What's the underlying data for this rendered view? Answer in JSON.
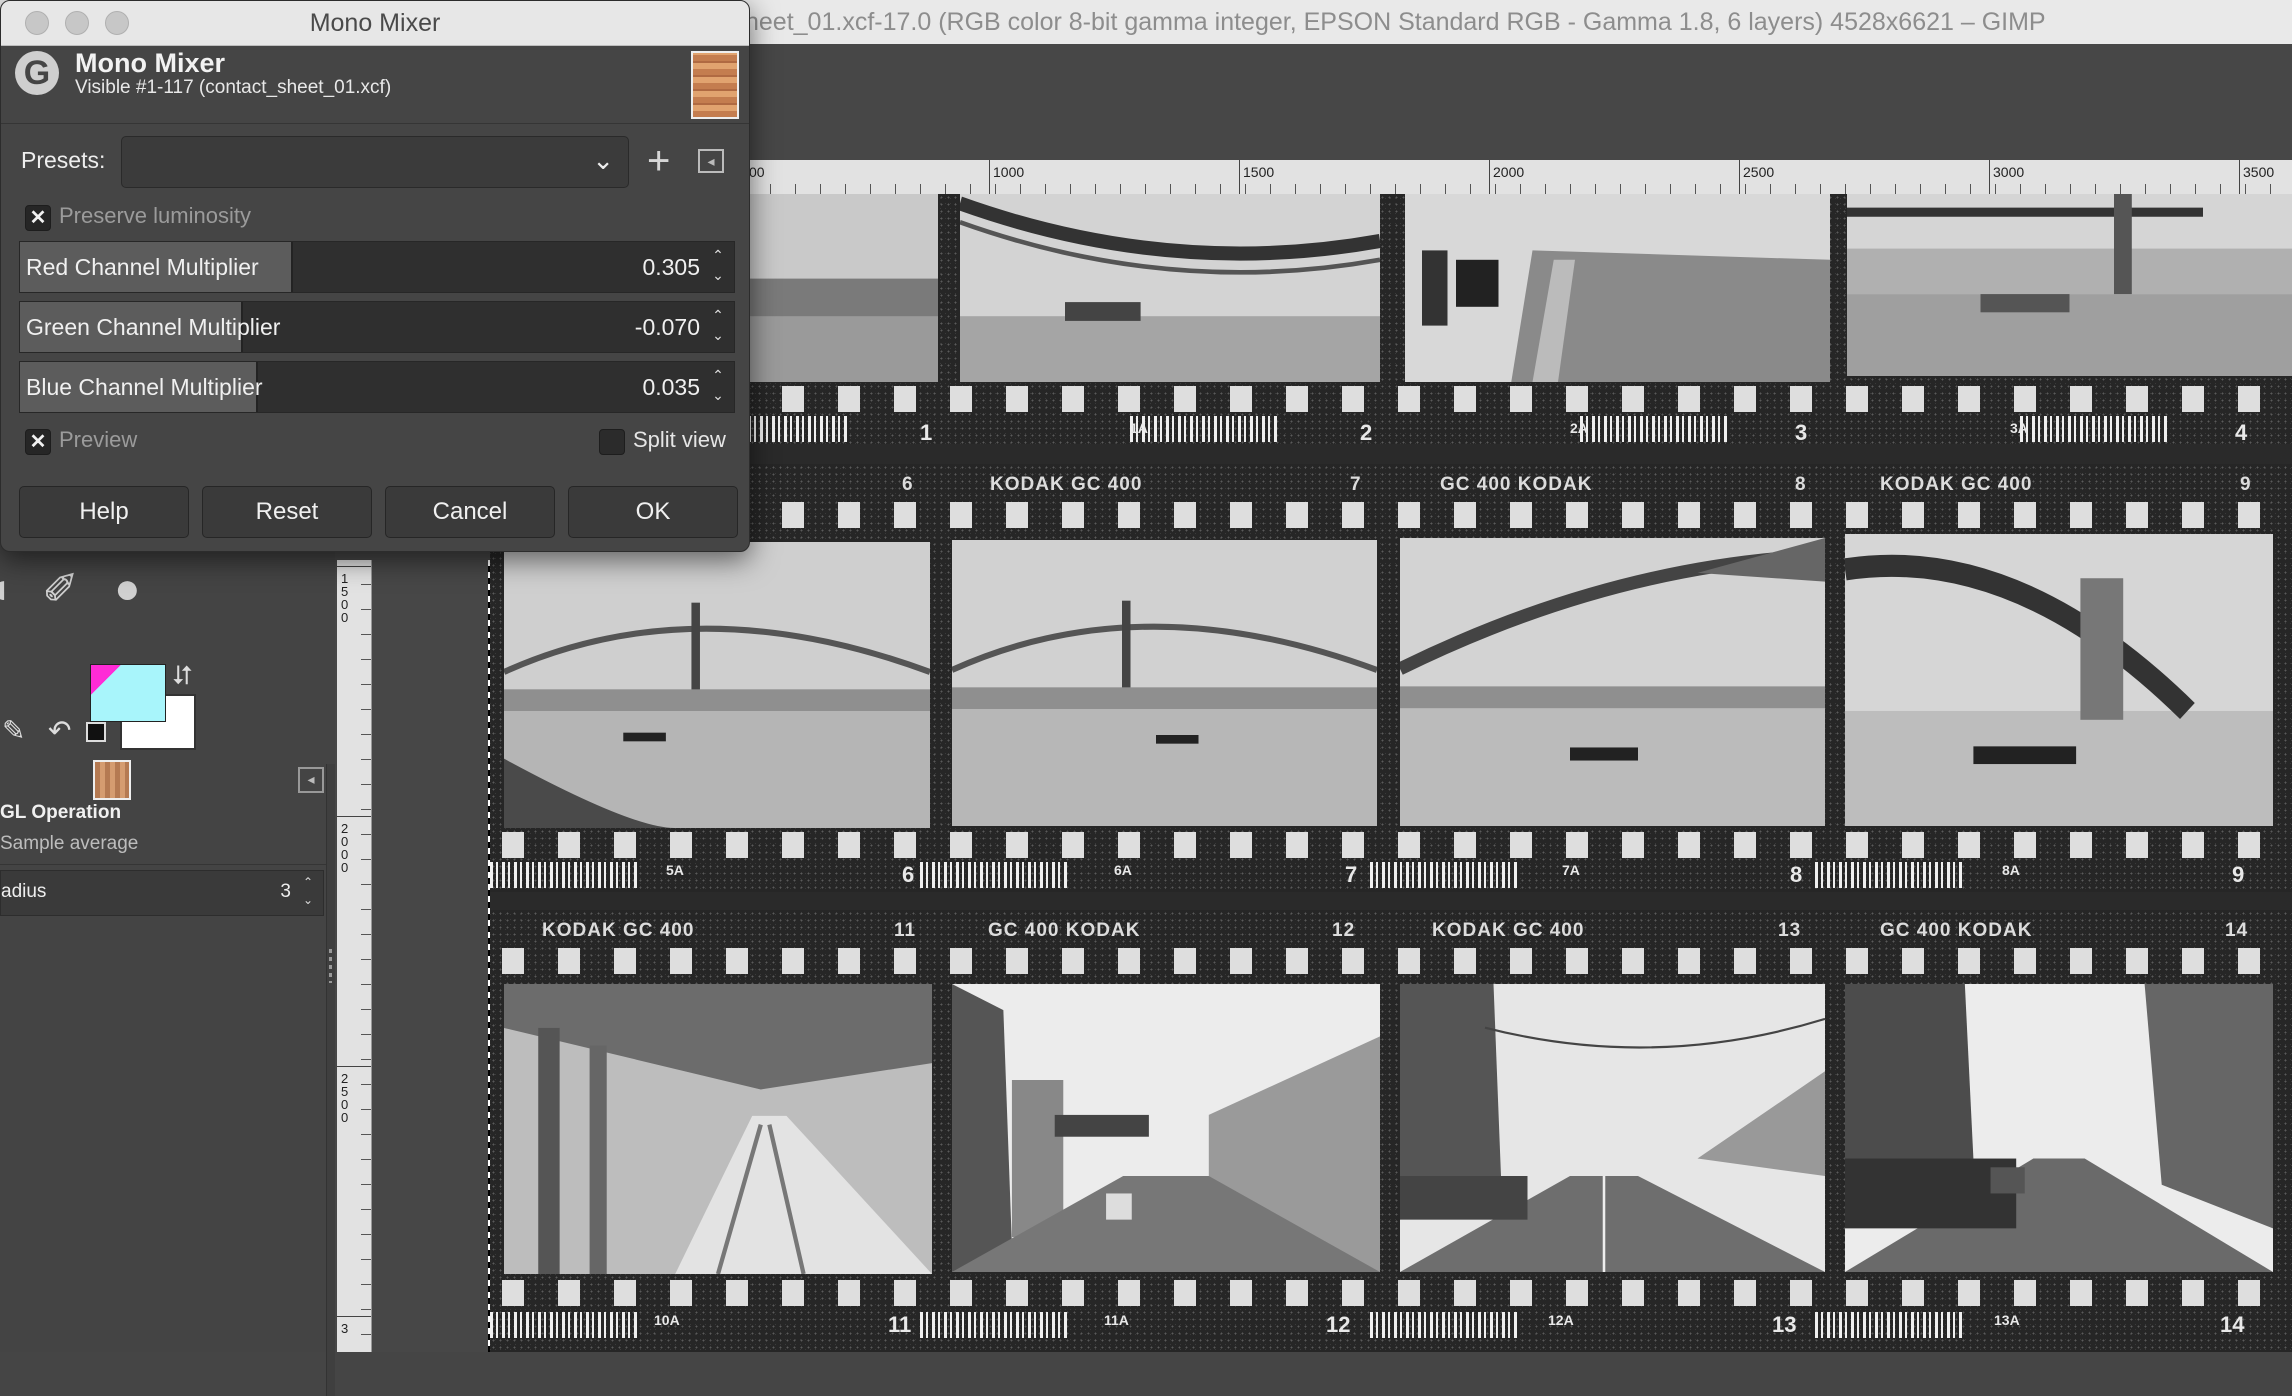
{
  "main_window": {
    "title": "heet_01.xcf-17.0 (RGB color 8-bit gamma integer, EPSON  Standard RGB - Gamma 1.8, 6 layers) 4528x6621 – GIMP"
  },
  "toolbox": {
    "tool_options": {
      "title": "GL Operation",
      "sample": "Sample average",
      "radius_label": "adius",
      "radius_value": "3"
    }
  },
  "rulers": {
    "horizontal": [
      "00",
      "1000",
      "1500",
      "2000",
      "2500",
      "3000",
      "3500"
    ],
    "vertical": [
      "1500",
      "2000",
      "2500",
      "3"
    ]
  },
  "contact_sheet": {
    "strip1": {
      "numbers": [
        "1",
        "1A",
        "2",
        "2A",
        "3",
        "3A",
        "4"
      ]
    },
    "strip2": {
      "edge": [
        "6",
        "KODAK  GC 400",
        "7",
        "GC 400  KODAK",
        "8",
        "KODAK  GC 400",
        "9"
      ],
      "numbers": [
        "5A",
        "6",
        "6A",
        "7",
        "7A",
        "8",
        "8A",
        "9"
      ]
    },
    "strip3": {
      "edge": [
        "KODAK  GC 400",
        "11",
        "GC 400  KODAK",
        "12",
        "KODAK  GC 400",
        "13",
        "GC 400  KODAK",
        "14"
      ],
      "numbers": [
        "10A",
        "11",
        "11A",
        "12",
        "12A",
        "13",
        "13A",
        "14"
      ]
    }
  },
  "dialog": {
    "window_title": "Mono Mixer",
    "name": "Mono Mixer",
    "subtitle": "Visible #1-117 (contact_sheet_01.xcf)",
    "presets_label": "Presets:",
    "presets_value": "",
    "preserve_luminosity": {
      "label": "Preserve luminosity",
      "checked": true
    },
    "sliders": [
      {
        "label": "Red Channel Multiplier",
        "value": "0.305",
        "fill_fraction": 0.38
      },
      {
        "label": "Green Channel Multiplier",
        "value": "-0.070",
        "fill_fraction": 0.31
      },
      {
        "label": "Blue Channel Multiplier",
        "value": "0.035",
        "fill_fraction": 0.33
      }
    ],
    "preview": {
      "label": "Preview",
      "checked": true
    },
    "split_view": {
      "label": "Split view",
      "checked": false
    },
    "buttons": {
      "help": "Help",
      "reset": "Reset",
      "cancel": "Cancel",
      "ok": "OK"
    }
  },
  "colors": {
    "foreground": "#a8f5fb",
    "background": "#ffffff",
    "fg_corner": "#ff2bd6"
  }
}
